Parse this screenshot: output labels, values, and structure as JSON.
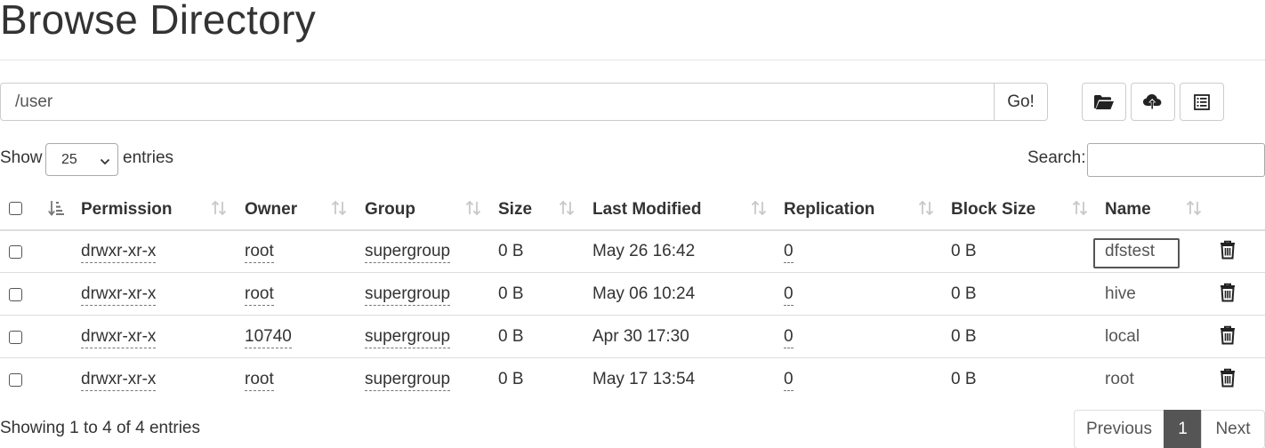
{
  "page": {
    "title": "Browse Directory"
  },
  "toolbar": {
    "path_value": "/user",
    "go_label": "Go!",
    "buttons": [
      {
        "icon": "folder-open-icon",
        "purpose": "create-directory"
      },
      {
        "icon": "cloud-upload-icon",
        "purpose": "upload"
      },
      {
        "icon": "list-icon",
        "purpose": "cut-paste"
      }
    ]
  },
  "length_control": {
    "show_label": "Show",
    "selected": "25",
    "entries_label": "entries"
  },
  "search": {
    "label": "Search:",
    "value": ""
  },
  "table": {
    "columns": [
      "Permission",
      "Owner",
      "Group",
      "Size",
      "Last Modified",
      "Replication",
      "Block Size",
      "Name"
    ],
    "rows": [
      {
        "permission": "drwxr-xr-x",
        "owner": "root",
        "group": "supergroup",
        "size": "0 B",
        "last_modified": "May 26 16:42",
        "replication": "0",
        "block_size": "0 B",
        "name": "dfstest",
        "focused": true
      },
      {
        "permission": "drwxr-xr-x",
        "owner": "root",
        "group": "supergroup",
        "size": "0 B",
        "last_modified": "May 06 10:24",
        "replication": "0",
        "block_size": "0 B",
        "name": "hive"
      },
      {
        "permission": "drwxr-xr-x",
        "owner": "10740",
        "group": "supergroup",
        "size": "0 B",
        "last_modified": "Apr 30 17:30",
        "replication": "0",
        "block_size": "0 B",
        "name": "local"
      },
      {
        "permission": "drwxr-xr-x",
        "owner": "root",
        "group": "supergroup",
        "size": "0 B",
        "last_modified": "May 17 13:54",
        "replication": "0",
        "block_size": "0 B",
        "name": "root"
      }
    ]
  },
  "footer": {
    "info": "Showing 1 to 4 of 4 entries",
    "pagination": {
      "previous": "Previous",
      "current": "1",
      "next": "Next"
    }
  },
  "colors": {
    "text": "#333333",
    "border": "#cccccc",
    "active_page": "#555555"
  }
}
